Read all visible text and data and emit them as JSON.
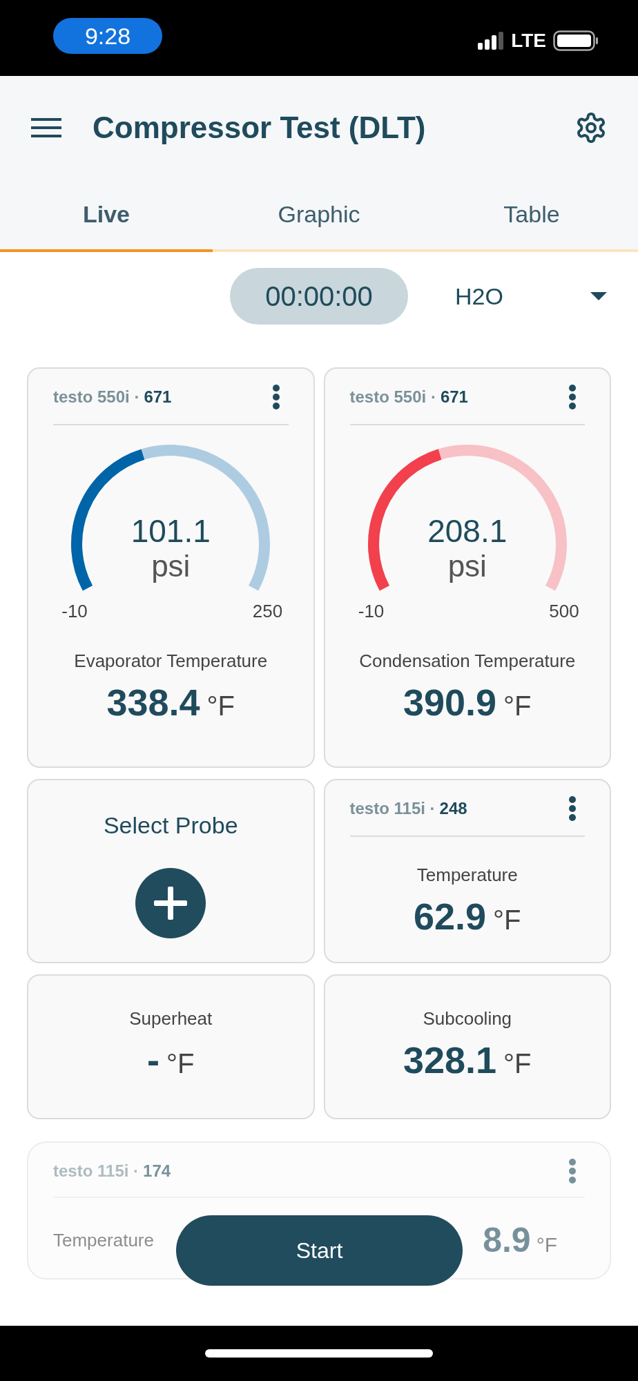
{
  "status_bar": {
    "time": "9:28",
    "network": "LTE"
  },
  "header": {
    "title": "Compressor Test (DLT)"
  },
  "tabs": [
    {
      "label": "Live",
      "selected": true
    },
    {
      "label": "Graphic",
      "selected": false
    },
    {
      "label": "Table",
      "selected": false
    }
  ],
  "timer": "00:00:00",
  "medium": {
    "value": "H2O"
  },
  "tiles": [
    {
      "kind": "gauge",
      "device": "testo 550i ·",
      "serial": "671",
      "reading": "101.1",
      "unit": "psi",
      "min": "-10",
      "max": "250",
      "color": "#0064a8",
      "label": "Evaporator Temperature",
      "value": "338.4",
      "value_unit": "°F"
    },
    {
      "kind": "gauge",
      "device": "testo 550i ·",
      "serial": "671",
      "reading": "208.1",
      "unit": "psi",
      "min": "-10",
      "max": "500",
      "color": "#f2404c",
      "label": "Condensation Temperature",
      "value": "390.9",
      "value_unit": "°F"
    },
    {
      "kind": "select",
      "label": "Select Probe"
    },
    {
      "kind": "probe",
      "device": "testo 115i ·",
      "serial": "248",
      "label": "Temperature",
      "value": "62.9",
      "value_unit": "°F"
    },
    {
      "kind": "calc",
      "label": "Superheat",
      "value": "-",
      "value_unit": "°F"
    },
    {
      "kind": "calc",
      "label": "Subcooling",
      "value": "328.1",
      "value_unit": "°F"
    }
  ],
  "faded_tile": {
    "device": "testo 115i ·",
    "serial": "174",
    "label": "Temperature",
    "value": "8.9",
    "value_unit": "°F"
  },
  "start_button": "Start"
}
